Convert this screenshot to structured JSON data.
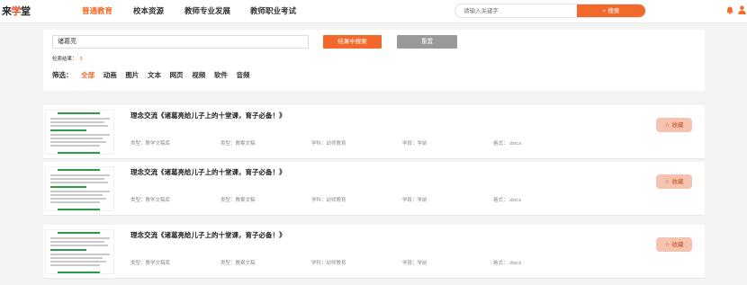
{
  "header": {
    "logo_prefix": "来",
    "logo_mid": "学",
    "logo_suffix": "堂",
    "nav": [
      "普通教育",
      "校本资源",
      "教师专业发展",
      "教师职业考试"
    ],
    "active_index": 0,
    "search_placeholder": "请输入关键字",
    "search_button": "⌕ 搜索"
  },
  "search_panel": {
    "keyword": "诸葛亮",
    "search_within_label": "结果中搜索",
    "reset_label": "重置",
    "stat_label": "检索结果：",
    "stat_count": "5",
    "filter_label": "筛选：",
    "filters": [
      "全部",
      "动画",
      "图片",
      "文本",
      "网页",
      "视频",
      "软件",
      "音频"
    ],
    "active_filter": 0
  },
  "results": [
    {
      "title": "理念交流《诸葛亮给儿子上的十堂课，育子必备！》",
      "type": "类型：教学文稿库",
      "category": "类型：教案文稿",
      "subject": "学科：幼师教育",
      "stage": "学段：学前",
      "format": "格式：.docx",
      "fav_label": "☆ 收藏"
    },
    {
      "title": "理念交流《诸葛亮给儿子上的十堂课，育子必备！》",
      "type": "类型：教学文稿库",
      "category": "类型：教案文稿",
      "subject": "学科：幼师教育",
      "stage": "学段：学前",
      "format": "格式：.docx",
      "fav_label": "☆ 收藏"
    },
    {
      "title": "理念交流《诸葛亮给儿子上的十堂课，育子必备！》",
      "type": "类型：教学文稿库",
      "category": "类型：教案文稿",
      "subject": "学科：幼师教育",
      "stage": "学段：学前",
      "format": "格式：.docx",
      "fav_label": "☆ 收藏"
    }
  ],
  "colors": {
    "accent": "#f26b2a",
    "thumb_green": "#2e9a49",
    "fav_bg": "#f7c3b1"
  },
  "icons": {
    "bell": "bell-icon",
    "user": "user-icon",
    "star": "star-icon"
  }
}
